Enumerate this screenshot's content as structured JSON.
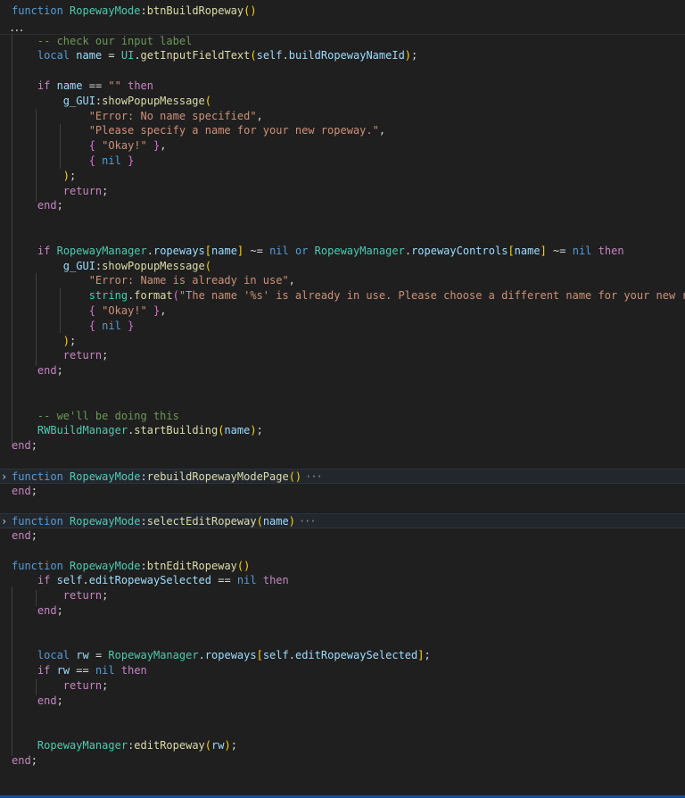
{
  "fold_marker": "...",
  "fold_ellipsis": "···",
  "lines": [
    {
      "y": 0,
      "indent": 0,
      "tokens": [
        [
          "kw",
          "function"
        ],
        [
          "pl",
          " "
        ],
        [
          "cls",
          "RopewayMode"
        ],
        [
          "op",
          ":"
        ],
        [
          "fn",
          "btnBuildRopeway"
        ],
        [
          "br1",
          "()"
        ]
      ]
    },
    {
      "y": 1,
      "indent": 0,
      "tokens": [
        [
          "pl",
          ""
        ]
      ]
    },
    {
      "y": 2,
      "indent": 4,
      "tokens": [
        [
          "cmt",
          "-- check our input label"
        ]
      ]
    },
    {
      "y": 3,
      "indent": 4,
      "tokens": [
        [
          "kw",
          "local"
        ],
        [
          "pl",
          " "
        ],
        [
          "var",
          "name"
        ],
        [
          "op",
          " = "
        ],
        [
          "cls",
          "UI"
        ],
        [
          "op",
          "."
        ],
        [
          "fn",
          "getInputFieldText"
        ],
        [
          "br1",
          "("
        ],
        [
          "var",
          "self"
        ],
        [
          "op",
          "."
        ],
        [
          "var",
          "buildRopewayNameId"
        ],
        [
          "br1",
          ")"
        ],
        [
          "op",
          ";"
        ]
      ]
    },
    {
      "y": 4,
      "indent": 0,
      "tokens": [
        [
          "pl",
          ""
        ]
      ]
    },
    {
      "y": 5,
      "indent": 4,
      "tokens": [
        [
          "ctl",
          "if"
        ],
        [
          "pl",
          " "
        ],
        [
          "var",
          "name"
        ],
        [
          "op",
          " == "
        ],
        [
          "str",
          "\"\""
        ],
        [
          "pl",
          " "
        ],
        [
          "ctl",
          "then"
        ]
      ]
    },
    {
      "y": 6,
      "indent": 8,
      "tokens": [
        [
          "var",
          "g_GUI"
        ],
        [
          "op",
          ":"
        ],
        [
          "fn",
          "showPopupMessage"
        ],
        [
          "br1",
          "("
        ]
      ]
    },
    {
      "y": 7,
      "indent": 12,
      "tokens": [
        [
          "str",
          "\"Error: No name specified\""
        ],
        [
          "op",
          ","
        ]
      ]
    },
    {
      "y": 8,
      "indent": 12,
      "tokens": [
        [
          "str",
          "\"Please specify a name for your new ropeway.\""
        ],
        [
          "op",
          ","
        ]
      ]
    },
    {
      "y": 9,
      "indent": 12,
      "tokens": [
        [
          "br2",
          "{"
        ],
        [
          "pl",
          " "
        ],
        [
          "str",
          "\"Okay!\""
        ],
        [
          "pl",
          " "
        ],
        [
          "br2",
          "}"
        ],
        [
          "op",
          ","
        ]
      ]
    },
    {
      "y": 10,
      "indent": 12,
      "tokens": [
        [
          "br2",
          "{"
        ],
        [
          "pl",
          " "
        ],
        [
          "kw",
          "nil"
        ],
        [
          "pl",
          " "
        ],
        [
          "br2",
          "}"
        ]
      ]
    },
    {
      "y": 11,
      "indent": 8,
      "tokens": [
        [
          "br1",
          ")"
        ],
        [
          "op",
          ";"
        ]
      ]
    },
    {
      "y": 12,
      "indent": 8,
      "tokens": [
        [
          "ctl",
          "return"
        ],
        [
          "op",
          ";"
        ]
      ]
    },
    {
      "y": 13,
      "indent": 4,
      "tokens": [
        [
          "ctl",
          "end"
        ],
        [
          "op",
          ";"
        ]
      ]
    },
    {
      "y": 14,
      "indent": 0,
      "tokens": [
        [
          "pl",
          ""
        ]
      ]
    },
    {
      "y": 15,
      "indent": 0,
      "tokens": [
        [
          "pl",
          ""
        ]
      ]
    },
    {
      "y": 16,
      "indent": 4,
      "tokens": [
        [
          "ctl",
          "if"
        ],
        [
          "pl",
          " "
        ],
        [
          "cls",
          "RopewayManager"
        ],
        [
          "op",
          "."
        ],
        [
          "var",
          "ropeways"
        ],
        [
          "br1",
          "["
        ],
        [
          "var",
          "name"
        ],
        [
          "br1",
          "]"
        ],
        [
          "op",
          " ~= "
        ],
        [
          "kw",
          "nil"
        ],
        [
          "pl",
          " "
        ],
        [
          "kw",
          "or"
        ],
        [
          "pl",
          " "
        ],
        [
          "cls",
          "RopewayManager"
        ],
        [
          "op",
          "."
        ],
        [
          "var",
          "ropewayControls"
        ],
        [
          "br1",
          "["
        ],
        [
          "var",
          "name"
        ],
        [
          "br1",
          "]"
        ],
        [
          "op",
          " ~= "
        ],
        [
          "kw",
          "nil"
        ],
        [
          "pl",
          " "
        ],
        [
          "ctl",
          "then"
        ]
      ]
    },
    {
      "y": 17,
      "indent": 8,
      "tokens": [
        [
          "var",
          "g_GUI"
        ],
        [
          "op",
          ":"
        ],
        [
          "fn",
          "showPopupMessage"
        ],
        [
          "br1",
          "("
        ]
      ]
    },
    {
      "y": 18,
      "indent": 12,
      "tokens": [
        [
          "str",
          "\"Error: Name is already in use\""
        ],
        [
          "op",
          ","
        ]
      ]
    },
    {
      "y": 19,
      "indent": 12,
      "tokens": [
        [
          "cls",
          "string"
        ],
        [
          "op",
          "."
        ],
        [
          "fn",
          "format"
        ],
        [
          "br2",
          "("
        ],
        [
          "str",
          "\"The name '%s' is already in use. Please choose a different name for your new ropeway"
        ]
      ]
    },
    {
      "y": 20,
      "indent": 12,
      "tokens": [
        [
          "br2",
          "{"
        ],
        [
          "pl",
          " "
        ],
        [
          "str",
          "\"Okay!\""
        ],
        [
          "pl",
          " "
        ],
        [
          "br2",
          "}"
        ],
        [
          "op",
          ","
        ]
      ]
    },
    {
      "y": 21,
      "indent": 12,
      "tokens": [
        [
          "br2",
          "{"
        ],
        [
          "pl",
          " "
        ],
        [
          "kw",
          "nil"
        ],
        [
          "pl",
          " "
        ],
        [
          "br2",
          "}"
        ]
      ]
    },
    {
      "y": 22,
      "indent": 8,
      "tokens": [
        [
          "br1",
          ")"
        ],
        [
          "op",
          ";"
        ]
      ]
    },
    {
      "y": 23,
      "indent": 8,
      "tokens": [
        [
          "ctl",
          "return"
        ],
        [
          "op",
          ";"
        ]
      ]
    },
    {
      "y": 24,
      "indent": 4,
      "tokens": [
        [
          "ctl",
          "end"
        ],
        [
          "op",
          ";"
        ]
      ]
    },
    {
      "y": 25,
      "indent": 0,
      "tokens": [
        [
          "pl",
          ""
        ]
      ]
    },
    {
      "y": 26,
      "indent": 0,
      "tokens": [
        [
          "pl",
          ""
        ]
      ]
    },
    {
      "y": 27,
      "indent": 4,
      "tokens": [
        [
          "cmt",
          "-- we'll be doing this"
        ]
      ]
    },
    {
      "y": 28,
      "indent": 4,
      "tokens": [
        [
          "cls",
          "RWBuildManager"
        ],
        [
          "op",
          "."
        ],
        [
          "fn",
          "startBuilding"
        ],
        [
          "br1",
          "("
        ],
        [
          "var",
          "name"
        ],
        [
          "br1",
          ")"
        ],
        [
          "op",
          ";"
        ]
      ]
    },
    {
      "y": 29,
      "indent": 0,
      "tokens": [
        [
          "ctl",
          "end"
        ],
        [
          "op",
          ";"
        ]
      ]
    },
    {
      "y": 30,
      "indent": 0,
      "tokens": [
        [
          "pl",
          ""
        ]
      ]
    },
    {
      "y": 31,
      "indent": 0,
      "folded": true,
      "tokens": [
        [
          "kw",
          "function"
        ],
        [
          "pl",
          " "
        ],
        [
          "cls",
          "RopewayMode"
        ],
        [
          "op",
          ":"
        ],
        [
          "fn",
          "rebuildRopewayModePage"
        ],
        [
          "br1",
          "()"
        ]
      ]
    },
    {
      "y": 32,
      "indent": 0,
      "tokens": [
        [
          "ctl",
          "end"
        ],
        [
          "op",
          ";"
        ]
      ]
    },
    {
      "y": 33,
      "indent": 0,
      "tokens": [
        [
          "pl",
          ""
        ]
      ]
    },
    {
      "y": 34,
      "indent": 0,
      "folded": true,
      "tokens": [
        [
          "kw",
          "function"
        ],
        [
          "pl",
          " "
        ],
        [
          "cls",
          "RopewayMode"
        ],
        [
          "op",
          ":"
        ],
        [
          "fn",
          "selectEditRopeway"
        ],
        [
          "br1",
          "("
        ],
        [
          "var",
          "name"
        ],
        [
          "br1",
          ")"
        ]
      ]
    },
    {
      "y": 35,
      "indent": 0,
      "tokens": [
        [
          "ctl",
          "end"
        ],
        [
          "op",
          ";"
        ]
      ]
    },
    {
      "y": 36,
      "indent": 0,
      "tokens": [
        [
          "pl",
          ""
        ]
      ]
    },
    {
      "y": 37,
      "indent": 0,
      "tokens": [
        [
          "kw",
          "function"
        ],
        [
          "pl",
          " "
        ],
        [
          "cls",
          "RopewayMode"
        ],
        [
          "op",
          ":"
        ],
        [
          "fn",
          "btnEditRopeway"
        ],
        [
          "br1",
          "()"
        ]
      ]
    },
    {
      "y": 38,
      "indent": 4,
      "tokens": [
        [
          "ctl",
          "if"
        ],
        [
          "pl",
          " "
        ],
        [
          "var",
          "self"
        ],
        [
          "op",
          "."
        ],
        [
          "var",
          "editRopewaySelected"
        ],
        [
          "op",
          " == "
        ],
        [
          "kw",
          "nil"
        ],
        [
          "pl",
          " "
        ],
        [
          "ctl",
          "then"
        ]
      ]
    },
    {
      "y": 39,
      "indent": 8,
      "tokens": [
        [
          "ctl",
          "return"
        ],
        [
          "op",
          ";"
        ]
      ]
    },
    {
      "y": 40,
      "indent": 4,
      "tokens": [
        [
          "ctl",
          "end"
        ],
        [
          "op",
          ";"
        ]
      ]
    },
    {
      "y": 41,
      "indent": 0,
      "tokens": [
        [
          "pl",
          ""
        ]
      ]
    },
    {
      "y": 42,
      "indent": 0,
      "tokens": [
        [
          "pl",
          ""
        ]
      ]
    },
    {
      "y": 43,
      "indent": 4,
      "tokens": [
        [
          "kw",
          "local"
        ],
        [
          "pl",
          " "
        ],
        [
          "var",
          "rw"
        ],
        [
          "op",
          " = "
        ],
        [
          "cls",
          "RopewayManager"
        ],
        [
          "op",
          "."
        ],
        [
          "var",
          "ropeways"
        ],
        [
          "br1",
          "["
        ],
        [
          "var",
          "self"
        ],
        [
          "op",
          "."
        ],
        [
          "var",
          "editRopewaySelected"
        ],
        [
          "br1",
          "]"
        ],
        [
          "op",
          ";"
        ]
      ]
    },
    {
      "y": 44,
      "indent": 4,
      "tokens": [
        [
          "ctl",
          "if"
        ],
        [
          "pl",
          " "
        ],
        [
          "var",
          "rw"
        ],
        [
          "op",
          " == "
        ],
        [
          "kw",
          "nil"
        ],
        [
          "pl",
          " "
        ],
        [
          "ctl",
          "then"
        ]
      ]
    },
    {
      "y": 45,
      "indent": 8,
      "tokens": [
        [
          "ctl",
          "return"
        ],
        [
          "op",
          ";"
        ]
      ]
    },
    {
      "y": 46,
      "indent": 4,
      "tokens": [
        [
          "ctl",
          "end"
        ],
        [
          "op",
          ";"
        ]
      ]
    },
    {
      "y": 47,
      "indent": 0,
      "tokens": [
        [
          "pl",
          ""
        ]
      ]
    },
    {
      "y": 48,
      "indent": 0,
      "tokens": [
        [
          "pl",
          ""
        ]
      ]
    },
    {
      "y": 49,
      "indent": 4,
      "tokens": [
        [
          "cls",
          "RopewayManager"
        ],
        [
          "op",
          ":"
        ],
        [
          "fn",
          "editRopeway"
        ],
        [
          "br1",
          "("
        ],
        [
          "var",
          "rw"
        ],
        [
          "br1",
          ")"
        ],
        [
          "op",
          ";"
        ]
      ]
    },
    {
      "y": 50,
      "indent": 0,
      "tokens": [
        [
          "ctl",
          "end"
        ],
        [
          "op",
          ";"
        ]
      ]
    }
  ]
}
